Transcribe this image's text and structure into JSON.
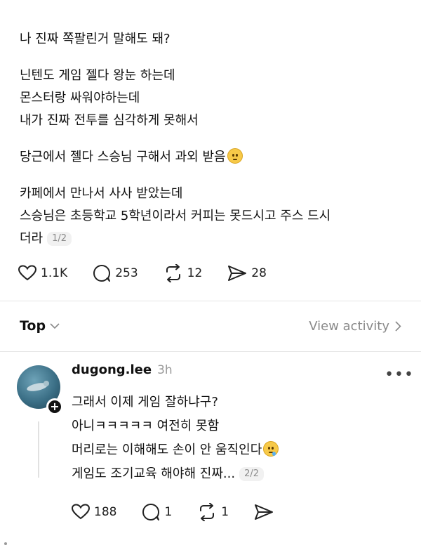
{
  "post": {
    "paragraphs": [
      [
        "나 진짜 쪽팔린거 말해도 돼?"
      ],
      [
        "닌텐도 게임 젤다 왕눈 하는데",
        "몬스터랑 싸워야하는데",
        "내가 진짜 전투를 심각하게 못해서"
      ],
      [
        "당근에서 젤다 스승님 구해서 과외 받음"
      ],
      [
        "카페에서 만나서 사사 받았는데",
        "스승님은 초등학교 5학년이라서 커피는 못드시고 주스 드시",
        "더라"
      ]
    ],
    "page_indicator": "1/2",
    "actions": {
      "likes": "1.1K",
      "comments": "253",
      "reposts": "12",
      "shares": "28"
    }
  },
  "sort": {
    "label": "Top",
    "view_activity": "View activity"
  },
  "reply": {
    "username": "dugong.lee",
    "time": "3h",
    "lines": [
      "그래서 이제 게임 잘하냐구?",
      "아니ㅋㅋㅋㅋㅋ 여전히 못함",
      "머리로는 이해해도 손이 안 움직인다",
      "게임도 조기교육 해야해 진짜..."
    ],
    "page_indicator": "2/2",
    "actions": {
      "likes": "188",
      "comments": "1",
      "reposts": "1"
    }
  },
  "icons": {
    "heart": "heart-icon",
    "comment": "comment-icon",
    "repost": "repost-icon",
    "share": "share-icon",
    "more": "more-icon",
    "chevron_down": "chevron-down-icon",
    "chevron_right": "chevron-right-icon",
    "follow_plus": "plus-icon"
  },
  "colors": {
    "text": "#111111",
    "muted": "#8a8a8a",
    "divider": "#e6e6e6"
  }
}
